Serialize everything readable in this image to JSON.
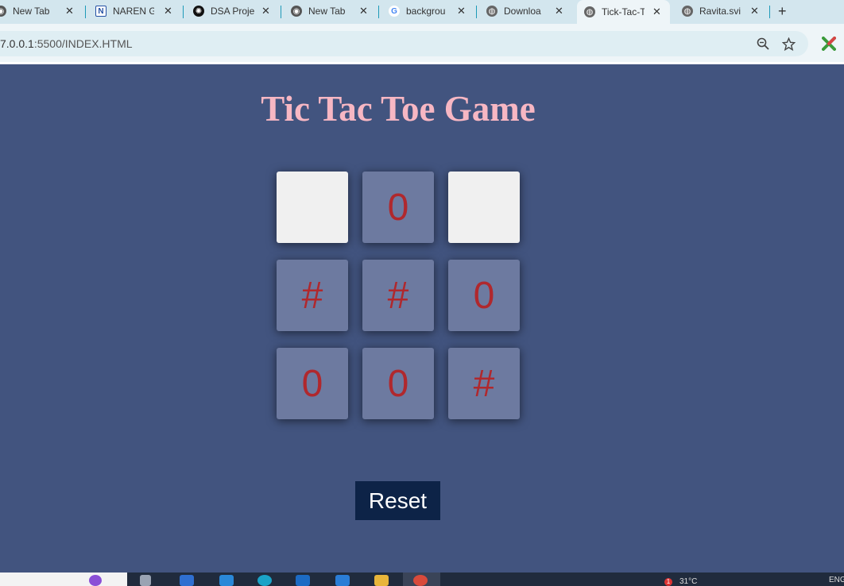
{
  "browser": {
    "tabs": [
      {
        "title": "New Tab",
        "icon": "chrome-icon",
        "active": false
      },
      {
        "title": "NAREN G",
        "icon": "notion-icon",
        "active": false
      },
      {
        "title": "DSA Proje",
        "icon": "openai-icon",
        "active": false
      },
      {
        "title": "New Tab",
        "icon": "chrome-icon",
        "active": false
      },
      {
        "title": "backgrou",
        "icon": "google-icon",
        "active": false
      },
      {
        "title": "Downloa",
        "icon": "globe-icon",
        "active": false
      },
      {
        "title": "Tick-Tac-T",
        "icon": "globe-icon",
        "active": true
      },
      {
        "title": "Ravita.svi",
        "icon": "globe-icon",
        "active": false
      }
    ],
    "new_tab_label": "+",
    "address": {
      "host": "7.0.0.1",
      "path": ":5500/INDEX.HTML"
    }
  },
  "game": {
    "title": "Tic Tac Toe Game",
    "board": [
      "",
      "0",
      "",
      "#",
      "#",
      "0",
      "0",
      "0",
      "#"
    ],
    "reset_label": "Reset"
  },
  "colors": {
    "page_background": "#42547f",
    "title": "#f7b7c3",
    "cell_filled": "#6d7aa0",
    "cell_empty": "#f0f0f0",
    "mark": "#b0282d",
    "reset_button": "#0d2347"
  },
  "taskbar": {
    "tray_notification": "1",
    "tray_weather": "31°C",
    "tray_lang": "ENG"
  }
}
